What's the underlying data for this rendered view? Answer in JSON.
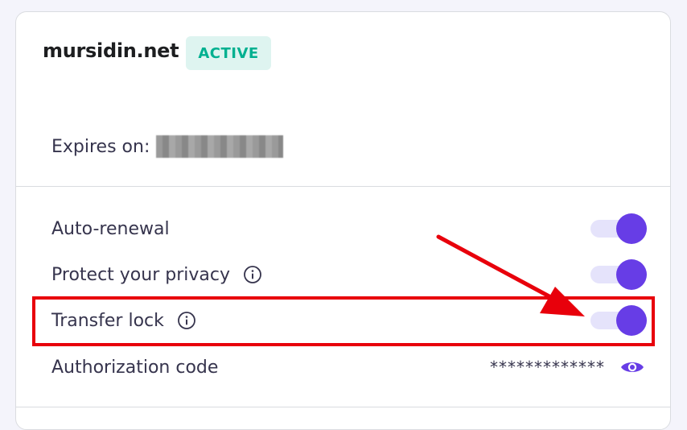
{
  "domain": {
    "name": "mursidin.net",
    "status": "ACTIVE",
    "status_bg": "#def4f0",
    "status_color": "#00b090"
  },
  "expires": {
    "label": "Expires on:"
  },
  "settings": {
    "auto_renewal": {
      "label": "Auto-renewal",
      "enabled": true
    },
    "privacy": {
      "label": "Protect your privacy",
      "enabled": true,
      "icon": "info-icon"
    },
    "transfer_lock": {
      "label": "Transfer lock",
      "enabled": true,
      "icon": "info-icon"
    },
    "authorization": {
      "label": "Authorization code",
      "value": "*************",
      "icon": "eye-icon"
    }
  },
  "colors": {
    "accent": "#673de6",
    "track": "#e5e3fb",
    "annotation": "#e8000b"
  }
}
